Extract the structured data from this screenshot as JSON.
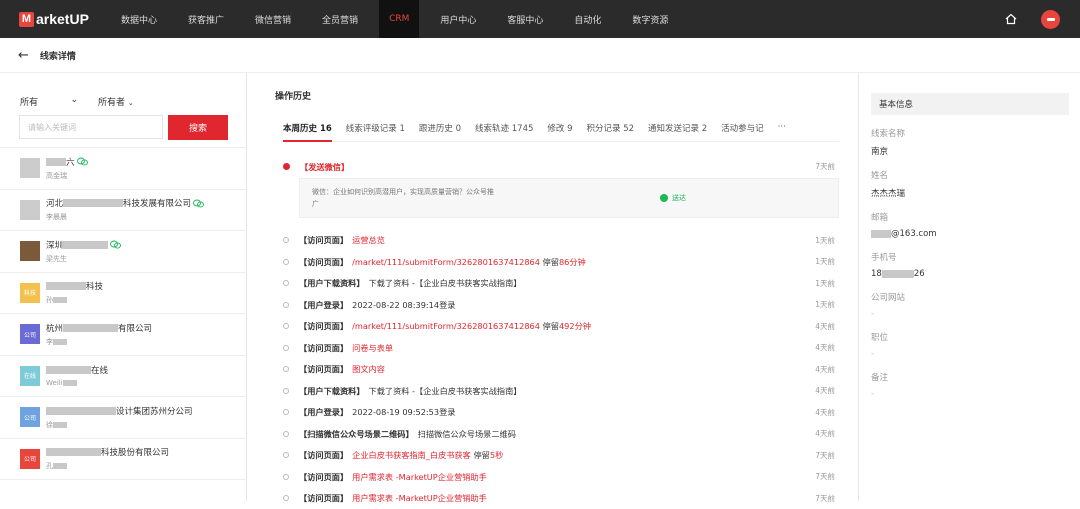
{
  "brand": {
    "logo_letter": "M",
    "name": "arketUP"
  },
  "nav": [
    {
      "label": "数据中心"
    },
    {
      "label": "获客推广"
    },
    {
      "label": "微信营销"
    },
    {
      "label": "全员营销"
    },
    {
      "label": "CRM",
      "active": true
    },
    {
      "label": "用户中心"
    },
    {
      "label": "客服中心"
    },
    {
      "label": "自动化"
    },
    {
      "label": "数字资源"
    }
  ],
  "page": {
    "title": "线索详情"
  },
  "filters": {
    "scope": "所有",
    "owner": "所有者",
    "search_placeholder": "请输入关键词",
    "search_button": "搜索"
  },
  "leads": [
    {
      "name_suffix": "六",
      "sub": "高金瑞",
      "thumb": "",
      "wechat": true
    },
    {
      "name_prefix": "河北",
      "name_suffix": "科技发展有限公司",
      "sub": "李晨晨",
      "thumb": "",
      "wechat": true
    },
    {
      "name_prefix": "深圳",
      "name_suffix": "",
      "sub": "梁先生",
      "thumb": "",
      "wechat": true
    },
    {
      "name_suffix": "科技",
      "sub": "孙",
      "thumb": "科技",
      "wechat": false
    },
    {
      "name_prefix": "杭州",
      "name_suffix": "有限公司",
      "sub": "李",
      "thumb": "公司",
      "wechat": false
    },
    {
      "name_suffix": "在线",
      "sub": "Weili",
      "thumb": "在线",
      "wechat": false
    },
    {
      "name_suffix": "设计集团苏州分公司",
      "sub": "徐",
      "thumb": "公司",
      "wechat": false
    },
    {
      "name_suffix": "科技股份有限公司",
      "sub": "孔",
      "thumb": "公司",
      "wechat": false
    }
  ],
  "history": {
    "title": "操作历史",
    "tabs": [
      {
        "label": "本周历史 16",
        "active": true
      },
      {
        "label": "线索评级记录 1"
      },
      {
        "label": "跟进历史 0"
      },
      {
        "label": "线索轨迹 1745"
      },
      {
        "label": "修改 9"
      },
      {
        "label": "积分记录 52"
      },
      {
        "label": "通知发送记录 2"
      },
      {
        "label": "活动参与记"
      },
      {
        "label": "···"
      }
    ],
    "wechat_event": {
      "tag": "【发送微信】",
      "time": "7天前",
      "content_line1": "微信：企业如何识别高潜用户，实现高质量营销？公众号推",
      "content_line2": "广",
      "status": "送达"
    },
    "events": [
      {
        "tag": "【访问页面】",
        "desc": "",
        "red": "运营总览",
        "tail": "",
        "time": "1天前"
      },
      {
        "tag": "【访问页面】",
        "desc": "",
        "red": "/market/111/submitForm/3262801637412864",
        "tail": " 停留",
        "tail_red": "86分钟",
        "time": "1天前"
      },
      {
        "tag": "【用户下载资料】",
        "desc": "下载了资料 -【企业白皮书获客实战指南】",
        "red": "",
        "tail": "",
        "time": "1天前"
      },
      {
        "tag": "【用户登录】",
        "desc": "2022-08-22 08:39:14登录",
        "red": "",
        "tail": "",
        "time": "1天前"
      },
      {
        "tag": "【访问页面】",
        "desc": "",
        "red": "/market/111/submitForm/3262801637412864",
        "tail": " 停留",
        "tail_red": "492分钟",
        "time": "4天前"
      },
      {
        "tag": "【访问页面】",
        "desc": "",
        "red": "问卷与表单",
        "tail": "",
        "time": "4天前"
      },
      {
        "tag": "【访问页面】",
        "desc": "",
        "red": "图文内容",
        "tail": "",
        "time": "4天前"
      },
      {
        "tag": "【用户下载资料】",
        "desc": "下载了资料 -【企业白皮书获客实战指南】",
        "red": "",
        "tail": "",
        "time": "4天前"
      },
      {
        "tag": "【用户登录】",
        "desc": "2022-08-19 09:52:53登录",
        "red": "",
        "tail": "",
        "time": "4天前"
      },
      {
        "tag": "【扫描微信公众号场景二维码】",
        "desc": "扫描微信公众号场景二维码",
        "red": "",
        "tail": "",
        "time": "4天前"
      },
      {
        "tag": "【访问页面】",
        "desc": "",
        "red": "企业白皮书获客指南_白皮书获客",
        "tail": " 停留",
        "tail_red": "5秒",
        "time": "7天前"
      },
      {
        "tag": "【访问页面】",
        "desc": "",
        "red": "用户需求表 -MarketUP企业营销助手",
        "tail": "",
        "time": "7天前"
      },
      {
        "tag": "【访问页面】",
        "desc": "",
        "red": "用户需求表 -MarketUP企业营销助手",
        "tail": "",
        "time": "7天前"
      }
    ]
  },
  "info": {
    "title": "基本信息",
    "fields": [
      {
        "label": "线索名称",
        "value": "南京"
      },
      {
        "label": "姓名",
        "value": "杰杰杰瑞"
      },
      {
        "label": "邮箱",
        "value": "@163.com"
      },
      {
        "label": "手机号",
        "value": "18",
        "value2": "26"
      },
      {
        "label": "公司网站",
        "value": "-"
      },
      {
        "label": "职位",
        "value": "-"
      },
      {
        "label": "备注",
        "value": "-"
      }
    ]
  },
  "colors": {
    "accent": "#e0262e",
    "topbar": "#2b2b2b",
    "wechat": "#19b955"
  }
}
